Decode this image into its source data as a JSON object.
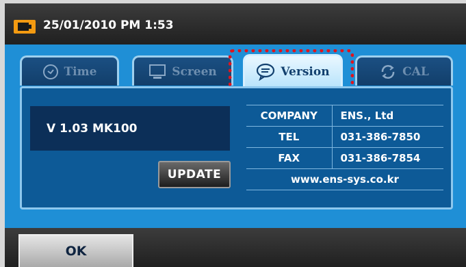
{
  "status": {
    "datetime": "25/01/2010  PM 1:53",
    "battery_icon": "battery-icon"
  },
  "tabs": [
    {
      "label": "Time",
      "icon": "clock-icon",
      "active": false
    },
    {
      "label": "Screen",
      "icon": "monitor-icon",
      "active": false
    },
    {
      "label": "Version",
      "icon": "speech-bubble-icon",
      "active": true
    },
    {
      "label": "CAL",
      "icon": "refresh-icon",
      "active": false
    }
  ],
  "version": {
    "text": "V 1.03 MK100",
    "update_label": "UPDATE"
  },
  "info": {
    "rows": [
      {
        "key": "COMPANY",
        "value": "ENS., Ltd"
      },
      {
        "key": "TEL",
        "value": "031-386-7850"
      },
      {
        "key": "FAX",
        "value": "031-386-7854"
      }
    ],
    "website": "www.ens-sys.co.kr"
  },
  "footer": {
    "ok_label": "OK"
  },
  "colors": {
    "panel_blue": "#1f8fd6",
    "content_blue": "#0d5a97",
    "highlight_red": "#e0141c",
    "battery_orange": "#f39a11"
  }
}
